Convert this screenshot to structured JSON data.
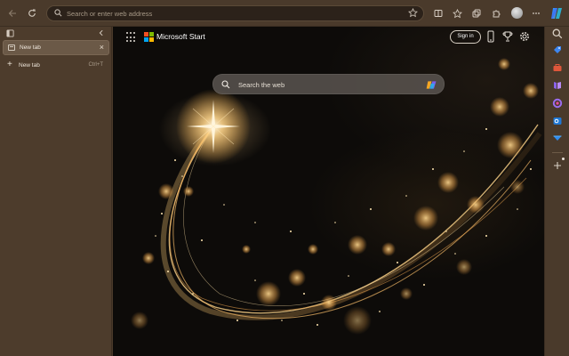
{
  "toolbar": {
    "back_icon": "back-arrow-icon",
    "refresh_icon": "refresh-icon",
    "address_placeholder": "Search or enter web address",
    "favorite_icon": "star-icon"
  },
  "tabs": {
    "items": [
      {
        "label": "New tab"
      }
    ],
    "new_tab": {
      "label": "New tab",
      "shortcut": "Ctrl+T"
    }
  },
  "page": {
    "brand": "Microsoft Start",
    "signin_label": "Sign in",
    "search_placeholder": "Search the web"
  },
  "colors": {
    "ms_red": "#f25022",
    "ms_green": "#7fba00",
    "ms_blue": "#00a4ef",
    "ms_yellow": "#ffb900",
    "sparkle_gold": "#ffc46b"
  }
}
